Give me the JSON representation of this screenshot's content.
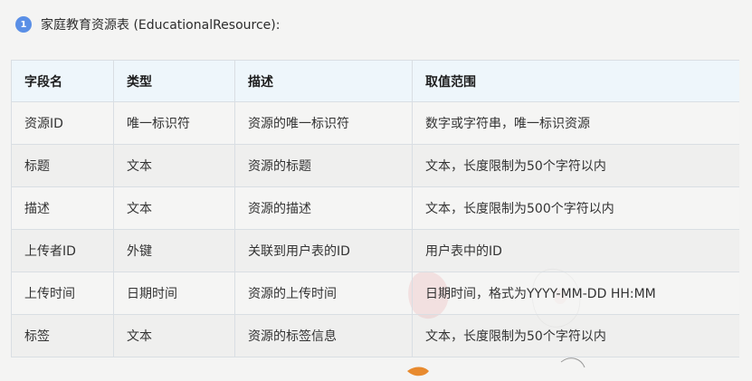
{
  "section": {
    "number": "1",
    "title": "家庭教育资源表 (EducationalResource):"
  },
  "table": {
    "headers": [
      "字段名",
      "类型",
      "描述",
      "取值范围"
    ],
    "rows": [
      [
        "资源ID",
        "唯一标识符",
        "资源的唯一标识符",
        "数字或字符串，唯一标识资源"
      ],
      [
        "标题",
        "文本",
        "资源的标题",
        "文本，长度限制为50个字符以内"
      ],
      [
        "描述",
        "文本",
        "资源的描述",
        "文本，长度限制为500个字符以内"
      ],
      [
        "上传者ID",
        "外键",
        "关联到用户表的ID",
        "用户表中的ID"
      ],
      [
        "上传时间",
        "日期时间",
        "资源的上传时间",
        "日期时间，格式为YYYY-MM-DD HH:MM"
      ],
      [
        "标签",
        "文本",
        "资源的标签信息",
        "文本，长度限制为50个字符以内"
      ]
    ]
  },
  "colors": {
    "badge": "#5a8fe6",
    "header_bg": "#eef6fb",
    "border": "#d9dee3",
    "balloon": "#d8242b"
  }
}
